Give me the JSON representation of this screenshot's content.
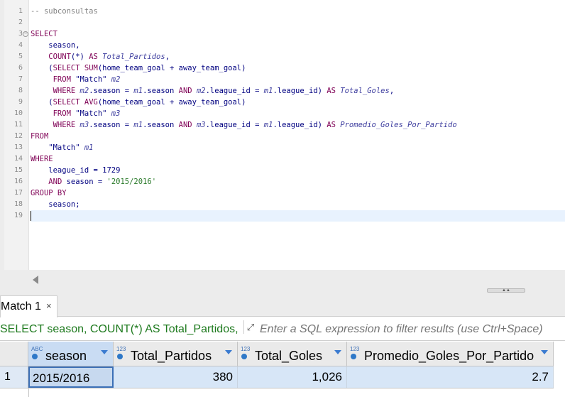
{
  "editor": {
    "line_numbers": [
      "1",
      "2",
      "3",
      "4",
      "5",
      "6",
      "7",
      "8",
      "9",
      "10",
      "11",
      "12",
      "13",
      "14",
      "15",
      "16",
      "17",
      "18",
      "19"
    ],
    "lines": [
      [
        {
          "t": "-- subconsultas",
          "c": "cm"
        }
      ],
      [],
      [
        {
          "t": "SELECT",
          "c": "kw"
        }
      ],
      [
        {
          "t": "    season,",
          "c": ""
        }
      ],
      [
        {
          "t": "    ",
          "c": ""
        },
        {
          "t": "COUNT",
          "c": "fn"
        },
        {
          "t": "(*) ",
          "c": ""
        },
        {
          "t": "AS ",
          "c": "kw"
        },
        {
          "t": "Total_Partidos",
          "c": "al"
        },
        {
          "t": ",",
          "c": ""
        }
      ],
      [
        {
          "t": "    (",
          "c": ""
        },
        {
          "t": "SELECT ",
          "c": "kw"
        },
        {
          "t": "SUM",
          "c": "fn"
        },
        {
          "t": "(home_team_goal + away_team_goal)",
          "c": ""
        }
      ],
      [
        {
          "t": "     ",
          "c": ""
        },
        {
          "t": "FROM ",
          "c": "kw"
        },
        {
          "t": "\"Match\" ",
          "c": ""
        },
        {
          "t": "m2",
          "c": "al"
        }
      ],
      [
        {
          "t": "     ",
          "c": ""
        },
        {
          "t": "WHERE ",
          "c": "kw"
        },
        {
          "t": "m2",
          "c": "al"
        },
        {
          "t": ".season = ",
          "c": ""
        },
        {
          "t": "m1",
          "c": "al"
        },
        {
          "t": ".season ",
          "c": ""
        },
        {
          "t": "AND ",
          "c": "kw"
        },
        {
          "t": "m2",
          "c": "al"
        },
        {
          "t": ".league_id = ",
          "c": ""
        },
        {
          "t": "m1",
          "c": "al"
        },
        {
          "t": ".league_id) ",
          "c": ""
        },
        {
          "t": "AS ",
          "c": "kw"
        },
        {
          "t": "Total_Goles",
          "c": "al"
        },
        {
          "t": ",",
          "c": ""
        }
      ],
      [
        {
          "t": "    (",
          "c": ""
        },
        {
          "t": "SELECT ",
          "c": "kw"
        },
        {
          "t": "AVG",
          "c": "fn"
        },
        {
          "t": "(home_team_goal + away_team_goal)",
          "c": ""
        }
      ],
      [
        {
          "t": "     ",
          "c": ""
        },
        {
          "t": "FROM ",
          "c": "kw"
        },
        {
          "t": "\"Match\" ",
          "c": ""
        },
        {
          "t": "m3",
          "c": "al"
        }
      ],
      [
        {
          "t": "     ",
          "c": ""
        },
        {
          "t": "WHERE ",
          "c": "kw"
        },
        {
          "t": "m3",
          "c": "al"
        },
        {
          "t": ".season = ",
          "c": ""
        },
        {
          "t": "m1",
          "c": "al"
        },
        {
          "t": ".season ",
          "c": ""
        },
        {
          "t": "AND ",
          "c": "kw"
        },
        {
          "t": "m3",
          "c": "al"
        },
        {
          "t": ".league_id = ",
          "c": ""
        },
        {
          "t": "m1",
          "c": "al"
        },
        {
          "t": ".league_id) ",
          "c": ""
        },
        {
          "t": "AS ",
          "c": "kw"
        },
        {
          "t": "Promedio_Goles_Por_Partido",
          "c": "al"
        }
      ],
      [
        {
          "t": "FROM",
          "c": "kw"
        }
      ],
      [
        {
          "t": "    \"Match\" ",
          "c": ""
        },
        {
          "t": "m1",
          "c": "al"
        }
      ],
      [
        {
          "t": "WHERE",
          "c": "kw"
        }
      ],
      [
        {
          "t": "    league_id = ",
          "c": ""
        },
        {
          "t": "1729",
          "c": "num"
        }
      ],
      [
        {
          "t": "    ",
          "c": ""
        },
        {
          "t": "AND ",
          "c": "kw"
        },
        {
          "t": "season = ",
          "c": ""
        },
        {
          "t": "'2015/2016'",
          "c": "str"
        }
      ],
      [
        {
          "t": "GROUP BY",
          "c": "kw"
        }
      ],
      [
        {
          "t": "    season;",
          "c": ""
        }
      ],
      []
    ],
    "current_line": 19
  },
  "results": {
    "tab_label": "Match 1",
    "tab_close": "×",
    "filter_query": "SELECT season, COUNT(*) AS Total_Partidos,",
    "filter_placeholder": "Enter a SQL expression to filter results (use Ctrl+Space)",
    "columns": [
      {
        "badge": "ABC",
        "label": "season"
      },
      {
        "badge": "123",
        "label": "Total_Partidos"
      },
      {
        "badge": "123",
        "label": "Total_Goles"
      },
      {
        "badge": "123",
        "label": "Promedio_Goles_Por_Partido"
      }
    ],
    "rows": [
      {
        "num": "1",
        "cells": [
          "2015/2016",
          "380",
          "1,026",
          "2.7"
        ]
      }
    ]
  }
}
